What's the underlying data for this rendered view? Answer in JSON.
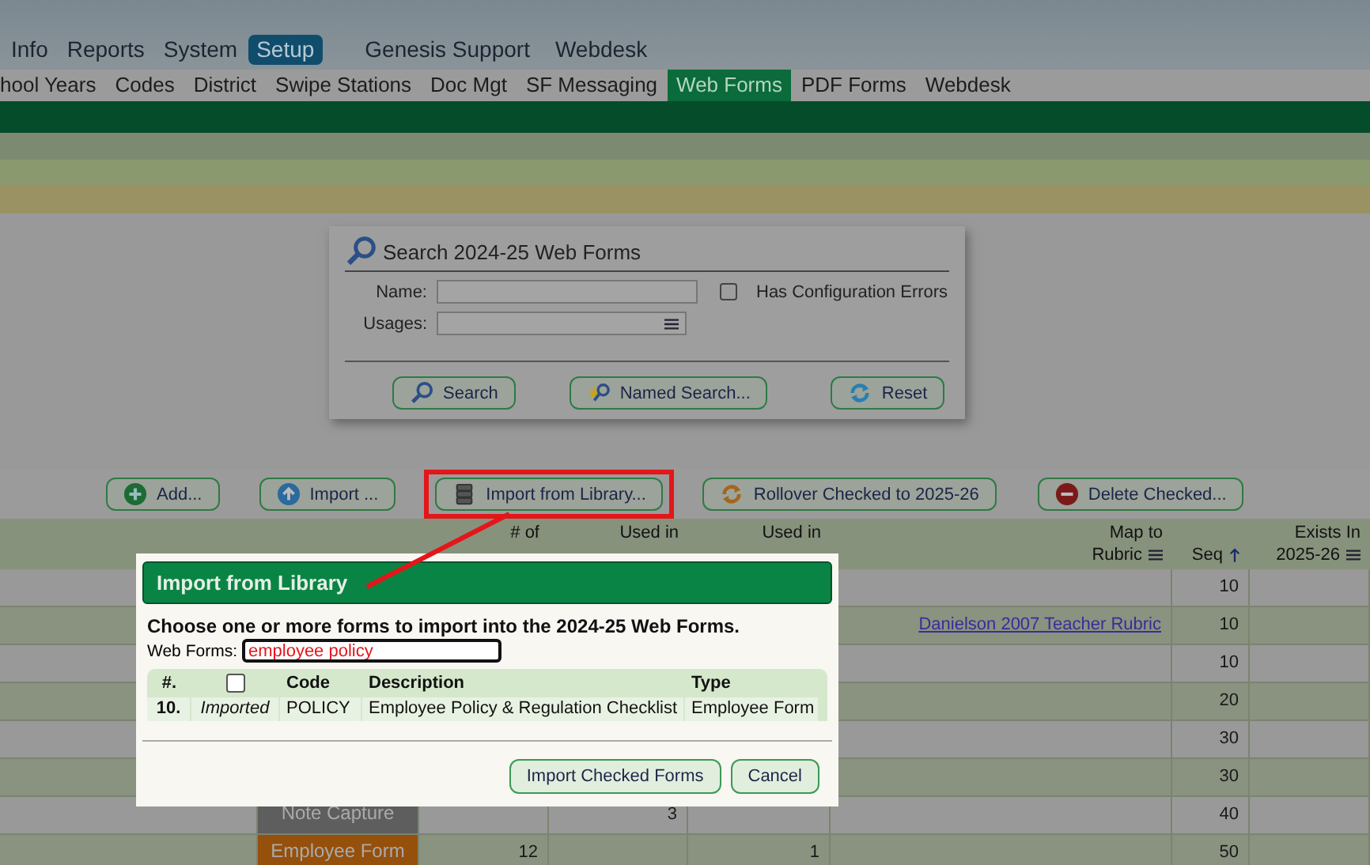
{
  "top_menu": [
    {
      "label": "Info",
      "selected": false
    },
    {
      "label": "Reports",
      "selected": false
    },
    {
      "label": "System",
      "selected": false
    },
    {
      "label": "Setup",
      "selected": true
    }
  ],
  "top_links": [
    "Genesis Support",
    "Webdesk"
  ],
  "sub_tabs": [
    {
      "label": "hool Years",
      "selected": false
    },
    {
      "label": "Codes",
      "selected": false
    },
    {
      "label": "District",
      "selected": false
    },
    {
      "label": "Swipe Stations",
      "selected": false
    },
    {
      "label": "Doc Mgt",
      "selected": false
    },
    {
      "label": "SF Messaging",
      "selected": false
    },
    {
      "label": "Web Forms",
      "selected": true
    },
    {
      "label": "PDF Forms",
      "selected": false
    },
    {
      "label": "Webdesk",
      "selected": false
    }
  ],
  "search_panel": {
    "title": "Search 2024-25 Web Forms",
    "name_label": "Name:",
    "usages_label": "Usages:",
    "checkbox": {
      "label": "Has Configuration Errors",
      "checked": false
    },
    "buttons": [
      {
        "label": "Search",
        "kind": "search"
      },
      {
        "label": "Named Search...",
        "kind": "named"
      },
      {
        "label": "Reset",
        "kind": "reset"
      }
    ]
  },
  "toolbar": [
    {
      "label": "Add...",
      "kind": "add",
      "highlighted": false
    },
    {
      "label": "Import ...",
      "kind": "import",
      "highlighted": false
    },
    {
      "label": "Import from Library...",
      "kind": "library",
      "highlighted": true
    },
    {
      "label": "Rollover Checked to 2025-26",
      "kind": "rollover",
      "highlighted": false
    },
    {
      "label": "Delete Checked...",
      "kind": "delete",
      "highlighted": false
    }
  ],
  "table": {
    "columns": [
      {},
      {},
      {
        "line1": "# of"
      },
      {
        "line1": "Used in"
      },
      {
        "line1": "Used in"
      },
      {
        "line1": "Map to",
        "line2": "Rubric",
        "menu": true
      },
      {
        "line2": "Seq",
        "sort": true
      },
      {
        "line1": "Exists In",
        "line2": "2025-26",
        "menu": true
      }
    ],
    "rows": [
      {
        "seq": "10"
      },
      {
        "map": "Danielson 2007 Teacher Rubric",
        "seq": "10"
      },
      {
        "seq": "10"
      },
      {
        "seq": "20"
      },
      {
        "seq": "30"
      },
      {
        "seq": "30"
      },
      {
        "usage": "Note Capture",
        "color": "#5e5e5e",
        "workflow": "3",
        "seq": "40"
      },
      {
        "usage": "Employee Form",
        "color": "#95500c",
        "count": "12",
        "form": "1",
        "seq": "50"
      }
    ]
  },
  "dialog": {
    "title": "Import from Library",
    "intro": "Choose one or more forms to import into the 2024-25 Web Forms.",
    "filter_label": "Web Forms:",
    "filter_value": "employee policy",
    "columns": [
      "#.",
      "Code",
      "Description",
      "Type"
    ],
    "select_all_checked": false,
    "rows": [
      {
        "number": "10.",
        "status": "Imported",
        "code": "POLICY",
        "description": "Employee Policy & Regulation Checklist",
        "type": "Employee Form"
      }
    ],
    "buttons": [
      "Import Checked Forms",
      "Cancel"
    ]
  }
}
